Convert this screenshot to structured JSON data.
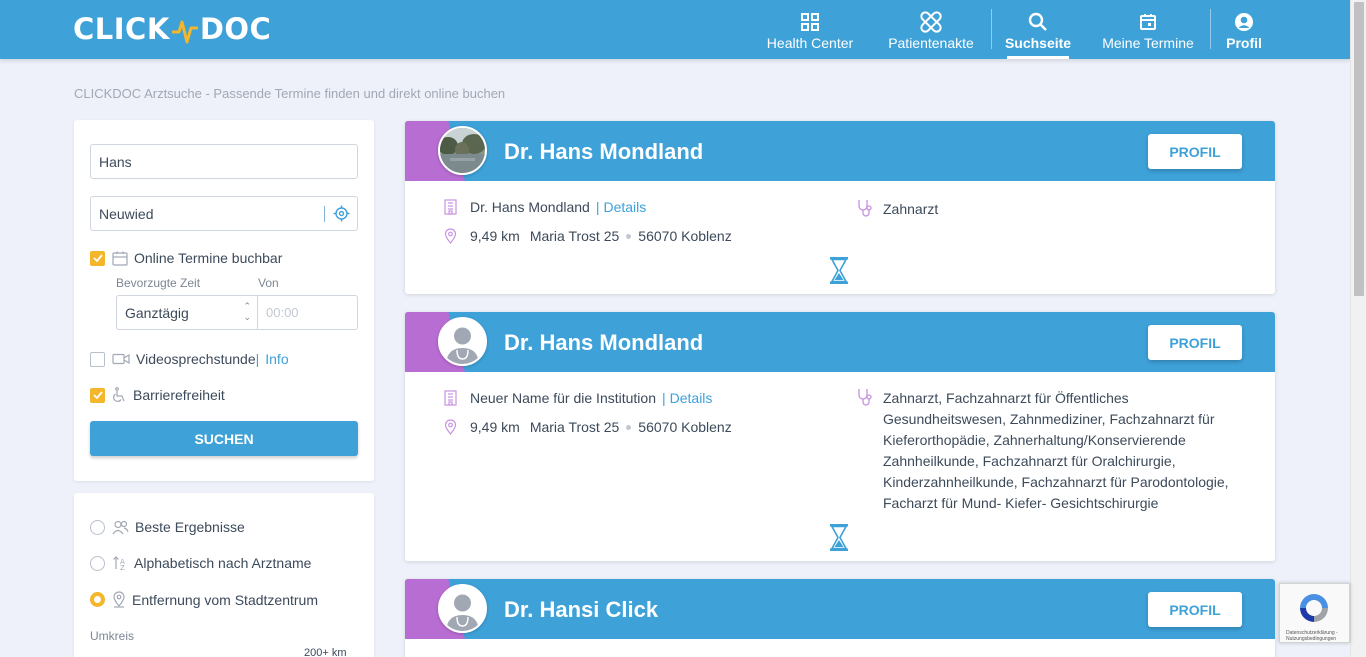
{
  "header": {
    "logo_left": "CLICK",
    "logo_right": "DOC",
    "nav": [
      {
        "label": "Health Center",
        "icon": "grid-icon"
      },
      {
        "label": "Patientenakte",
        "icon": "bandage-icon"
      },
      {
        "label": "Suchseite",
        "icon": "search-icon",
        "active": true
      },
      {
        "label": "Meine Termine",
        "icon": "calendar-icon"
      },
      {
        "label": "Profil",
        "icon": "user-circle-icon"
      }
    ]
  },
  "page": {
    "breadcrumb": "CLICKDOC Arztsuche - Passende Termine finden und direkt online buchen"
  },
  "search": {
    "name_value": "Hans",
    "location_value": "Neuwied",
    "online_label": "Online Termine buchbar",
    "online_checked": true,
    "preferred_time_label": "Bevorzugte Zeit",
    "from_label": "Von",
    "time_select_value": "Ganztägig",
    "time_placeholder": "00:00",
    "video_label": "Videosprechstunde",
    "video_info": "Info",
    "video_checked": false,
    "barrier_label": "Barrierefreiheit",
    "barrier_checked": true,
    "submit_label": "SUCHEN"
  },
  "sort": {
    "options": [
      {
        "label": "Beste Ergebnisse",
        "checked": false
      },
      {
        "label": "Alphabetisch nach Arztname",
        "checked": false
      },
      {
        "label": "Entfernung vom Stadtzentrum",
        "checked": true
      }
    ],
    "radius_label": "Umkreis",
    "radius_value": "200+ km"
  },
  "results": [
    {
      "name": "Dr. Hans Mondland",
      "profile_label": "PROFIL",
      "institution": "Dr. Hans Mondland",
      "details_label": "Details",
      "distance": "9,49 km",
      "street": "Maria Trost 25",
      "city": "56070 Koblenz",
      "specialty": "Zahnarzt",
      "avatar": "photo"
    },
    {
      "name": "Dr. Hans Mondland",
      "profile_label": "PROFIL",
      "institution": "Neuer Name für die Institution",
      "details_label": "Details",
      "distance": "9,49 km",
      "street": "Maria Trost 25",
      "city": "56070 Koblenz",
      "specialty": "Zahnarzt, Fachzahnarzt für Öffentliches Gesundheitswesen, Zahnmediziner, Fachzahnarzt für Kieferorthopädie, Zahnerhaltung/Konservierende Zahnheilkunde, Fachzahnarzt für Oralchirurgie, Kinderzahnheilkunde, Fachzahnarzt für Parodontologie, Facharzt für Mund- Kiefer- Gesichtschirurgie",
      "avatar": "placeholder"
    },
    {
      "name": "Dr. Hansi Click",
      "profile_label": "PROFIL",
      "avatar": "placeholder"
    }
  ],
  "recaptcha": {
    "text": "Datenschutzerklärung - Nutzungsbedingungen"
  },
  "colors": {
    "primary": "#3ea1d8",
    "accent_purple": "#b86dd2",
    "checkbox_yellow": "#f4b62b",
    "background": "#eef1fa"
  }
}
